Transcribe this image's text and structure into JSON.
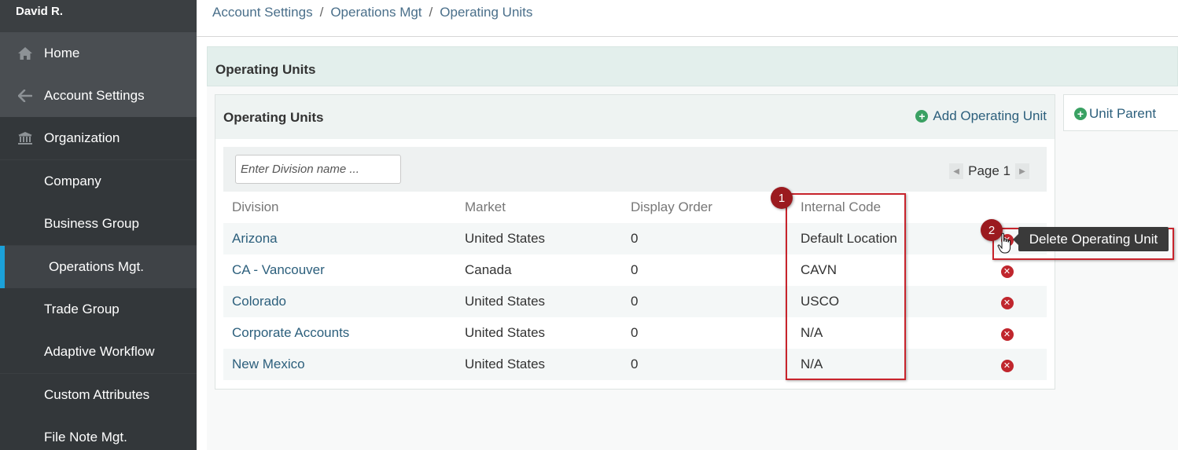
{
  "user": {
    "name": "David R."
  },
  "sidebar": {
    "items": [
      {
        "label": "Home",
        "icon": "home-icon"
      },
      {
        "label": "Account Settings",
        "icon": "arrow-left-icon"
      },
      {
        "label": "Organization",
        "icon": "bank-icon"
      },
      {
        "label": "Company"
      },
      {
        "label": "Business Group"
      },
      {
        "label": "Operations Mgt."
      },
      {
        "label": "Trade Group"
      },
      {
        "label": "Adaptive Workflow"
      },
      {
        "label": "Custom Attributes"
      },
      {
        "label": "File Note Mgt."
      }
    ],
    "active_item": "Operations Mgt.",
    "accent_color": "#1ba1d9"
  },
  "breadcrumb": [
    "Account Settings",
    "Operations Mgt",
    "Operating Units"
  ],
  "page": {
    "panel_title": "Operating Units"
  },
  "card": {
    "title": "Operating Units",
    "add_label": "Add Operating Unit",
    "search_placeholder": "Enter Division name ...",
    "pager_label": "Page 1"
  },
  "table": {
    "columns": [
      "Division",
      "Market",
      "Display Order",
      "Internal Code"
    ],
    "rows": [
      {
        "division": "Arizona",
        "market": "United States",
        "order": "0",
        "code": "Default Location"
      },
      {
        "division": "CA - Vancouver",
        "market": "Canada",
        "order": "0",
        "code": "CAVN"
      },
      {
        "division": "Colorado",
        "market": "United States",
        "order": "0",
        "code": "USCO"
      },
      {
        "division": "Corporate Accounts",
        "market": "United States",
        "order": "0",
        "code": "N/A"
      },
      {
        "division": "New Mexico",
        "market": "United States",
        "order": "0",
        "code": "N/A"
      }
    ]
  },
  "side_panel": {
    "unit_parent_label": "Unit Parent"
  },
  "annotations": {
    "badge_1": "1",
    "badge_2": "2",
    "tooltip": "Delete Operating Unit",
    "highlight_color": "#c8242c"
  }
}
